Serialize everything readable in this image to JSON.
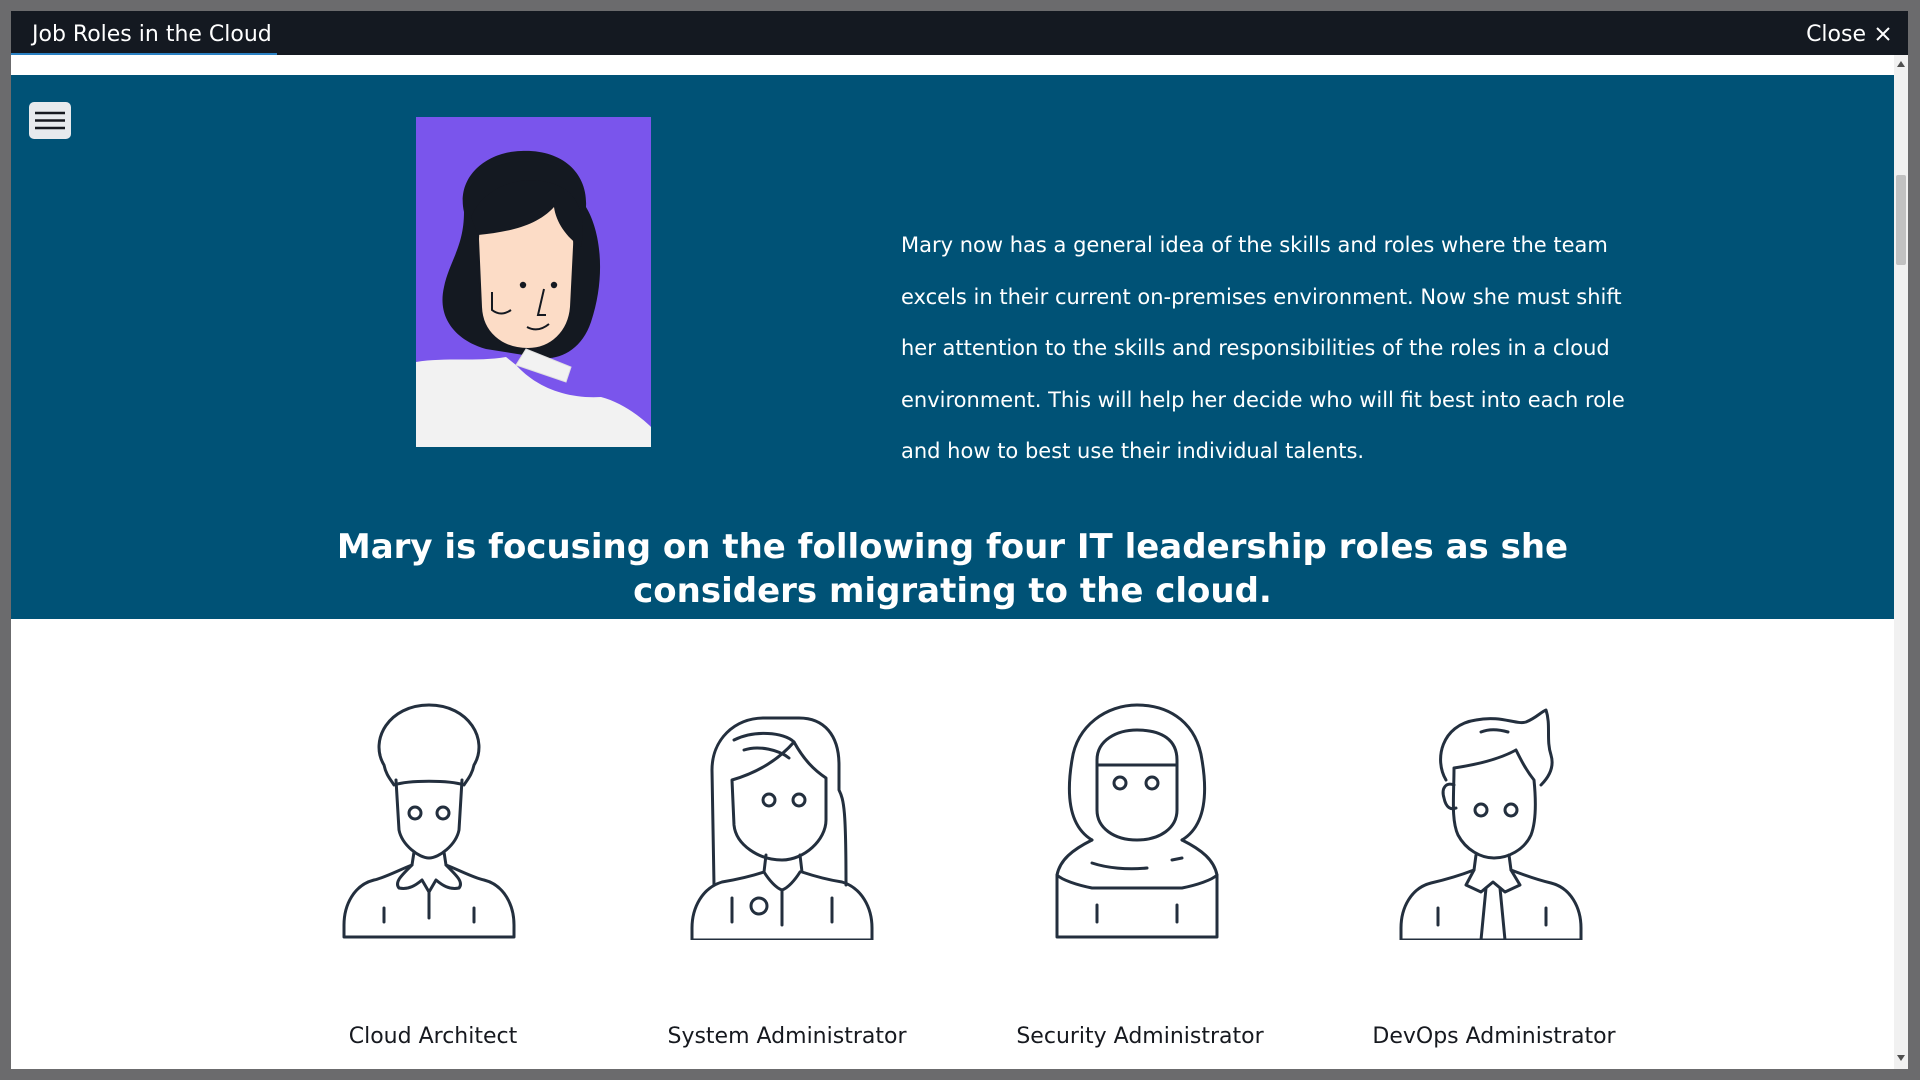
{
  "window": {
    "title": "Job Roles in the Cloud",
    "close_label": "Close",
    "close_icon": "close-icon"
  },
  "nav": {
    "menu_icon": "hamburger-menu-icon"
  },
  "intro": {
    "paragraph": "Mary now has a general idea of the skills and roles where the team excels in their current on-premises environment. Now she must shift her attention to the skills and responsibilities of the roles in a cloud environment. This will help her decide who will fit best into each role and how to best use their individual talents."
  },
  "headline": {
    "line1": "Mary is focusing on the following four IT leadership roles as she",
    "line2": "considers migrating to the cloud."
  },
  "roles": [
    {
      "label": "Cloud Architect",
      "icon": "cloud-architect-avatar-icon"
    },
    {
      "label": "System Administrator",
      "icon": "system-administrator-avatar-icon"
    },
    {
      "label": "Security Administrator",
      "icon": "security-administrator-avatar-icon"
    },
    {
      "label": "DevOps Administrator",
      "icon": "devops-administrator-avatar-icon"
    }
  ],
  "colors": {
    "hero_background": "#005276",
    "title_bar": "#141921",
    "portrait_background": "#7a55ec",
    "icon_stroke": "#232f3e"
  }
}
